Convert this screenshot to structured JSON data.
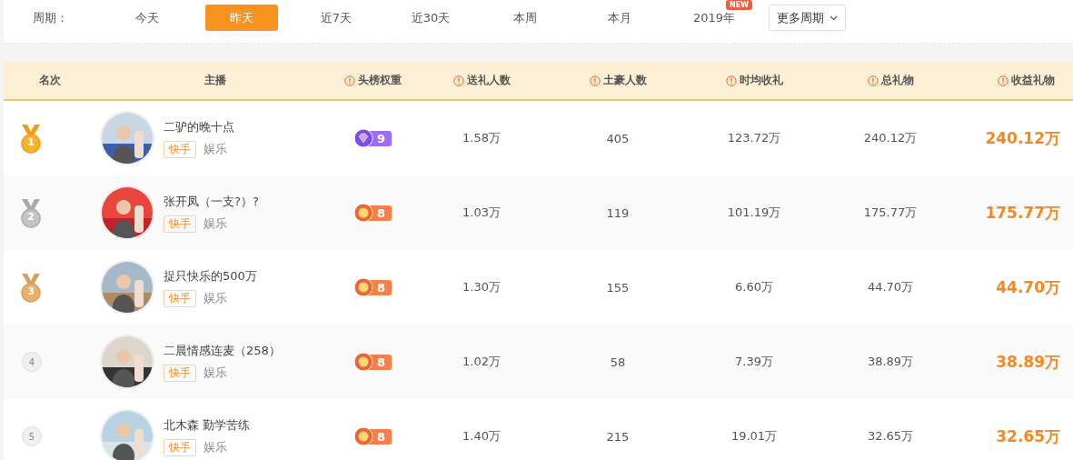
{
  "period_bar": {
    "label": "周期：",
    "tabs": [
      {
        "label": "今天",
        "selected": false
      },
      {
        "label": "昨天",
        "selected": true
      },
      {
        "label": "近7天",
        "selected": false
      },
      {
        "label": "近30天",
        "selected": false
      },
      {
        "label": "本周",
        "selected": false
      },
      {
        "label": "本月",
        "selected": false
      },
      {
        "label": "2019年",
        "selected": false,
        "badge": "NEW"
      }
    ],
    "dropdown": "更多周期"
  },
  "table": {
    "columns": [
      {
        "label": "名次",
        "info": false
      },
      {
        "label": "主播",
        "info": false
      },
      {
        "label": "头榜权重",
        "info": true
      },
      {
        "label": "送礼人数",
        "info": true
      },
      {
        "label": "土豪人数",
        "info": true
      },
      {
        "label": "时均收礼",
        "info": true
      },
      {
        "label": "总礼物",
        "info": true
      },
      {
        "label": "收益礼物",
        "info": true
      }
    ],
    "rows": [
      {
        "rank": {
          "text": "1",
          "kind": "gold"
        },
        "name": "二驴的晚十点",
        "platform": "快手",
        "category": "娱乐",
        "badge": {
          "kind": "diamond",
          "weight": "9"
        },
        "givers": "1.58万",
        "rich": "405",
        "hourly": "123.72万",
        "total": "240.12万",
        "income": "240.12万"
      },
      {
        "rank": {
          "text": "2",
          "kind": "silver"
        },
        "name": "张开凤（一支?）?",
        "platform": "快手",
        "category": "娱乐",
        "badge": {
          "kind": "sun",
          "weight": "8"
        },
        "givers": "1.03万",
        "rich": "119",
        "hourly": "101.19万",
        "total": "175.77万",
        "income": "175.77万"
      },
      {
        "rank": {
          "text": "3",
          "kind": "bronze"
        },
        "name": "捉只快乐的500万",
        "platform": "快手",
        "category": "娱乐",
        "badge": {
          "kind": "sun",
          "weight": "8"
        },
        "givers": "1.30万",
        "rich": "155",
        "hourly": "6.60万",
        "total": "44.70万",
        "income": "44.70万"
      },
      {
        "rank": {
          "text": "4",
          "kind": "plain"
        },
        "name": "二晨情感连麦（258）",
        "platform": "快手",
        "category": "娱乐",
        "badge": {
          "kind": "sun",
          "weight": "8"
        },
        "givers": "1.02万",
        "rich": "58",
        "hourly": "7.39万",
        "total": "38.89万",
        "income": "38.89万"
      },
      {
        "rank": {
          "text": "5",
          "kind": "plain"
        },
        "name": "北木森 勤学苦练",
        "platform": "快手",
        "category": "娱乐",
        "badge": {
          "kind": "sun",
          "weight": "8"
        },
        "givers": "1.40万",
        "rich": "215",
        "hourly": "19.01万",
        "total": "32.65万",
        "income": "32.65万"
      }
    ]
  }
}
